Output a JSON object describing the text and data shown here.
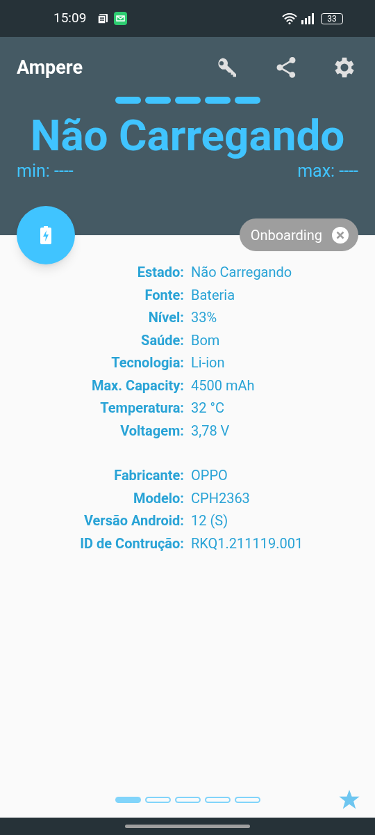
{
  "status_bar": {
    "time": "15:09",
    "battery": "33"
  },
  "app_bar": {
    "title": "Ampere"
  },
  "level_segments": [
    {
      "on": true
    },
    {
      "on": true
    },
    {
      "on": true
    },
    {
      "on": true
    },
    {
      "on": true
    }
  ],
  "headline": "Não Carregando",
  "min": "min: ----",
  "max": "max: ----",
  "chip": {
    "label": "Onboarding"
  },
  "info_groups": [
    [
      {
        "label": "Estado:",
        "value": "Não Carregando"
      },
      {
        "label": "Fonte:",
        "value": "Bateria"
      },
      {
        "label": "Nível:",
        "value": "33%"
      },
      {
        "label": "Saúde:",
        "value": "Bom"
      },
      {
        "label": "Tecnologia:",
        "value": "Li-ion"
      },
      {
        "label": "Max. Capacity:",
        "value": "4500 mAh"
      },
      {
        "label": "Temperatura:",
        "value": "32 °C"
      },
      {
        "label": "Voltagem:",
        "value": "3,78 V"
      }
    ],
    [
      {
        "label": "Fabricante:",
        "value": "OPPO"
      },
      {
        "label": "Modelo:",
        "value": "CPH2363"
      },
      {
        "label": "Versão Android:",
        "value": "12 (S)"
      },
      {
        "label": "ID de Contrução:",
        "value": "RKQ1.211119.001"
      }
    ]
  ],
  "pages": [
    {
      "selected": true
    },
    {
      "selected": false
    },
    {
      "selected": false
    },
    {
      "selected": false
    },
    {
      "selected": false
    }
  ]
}
